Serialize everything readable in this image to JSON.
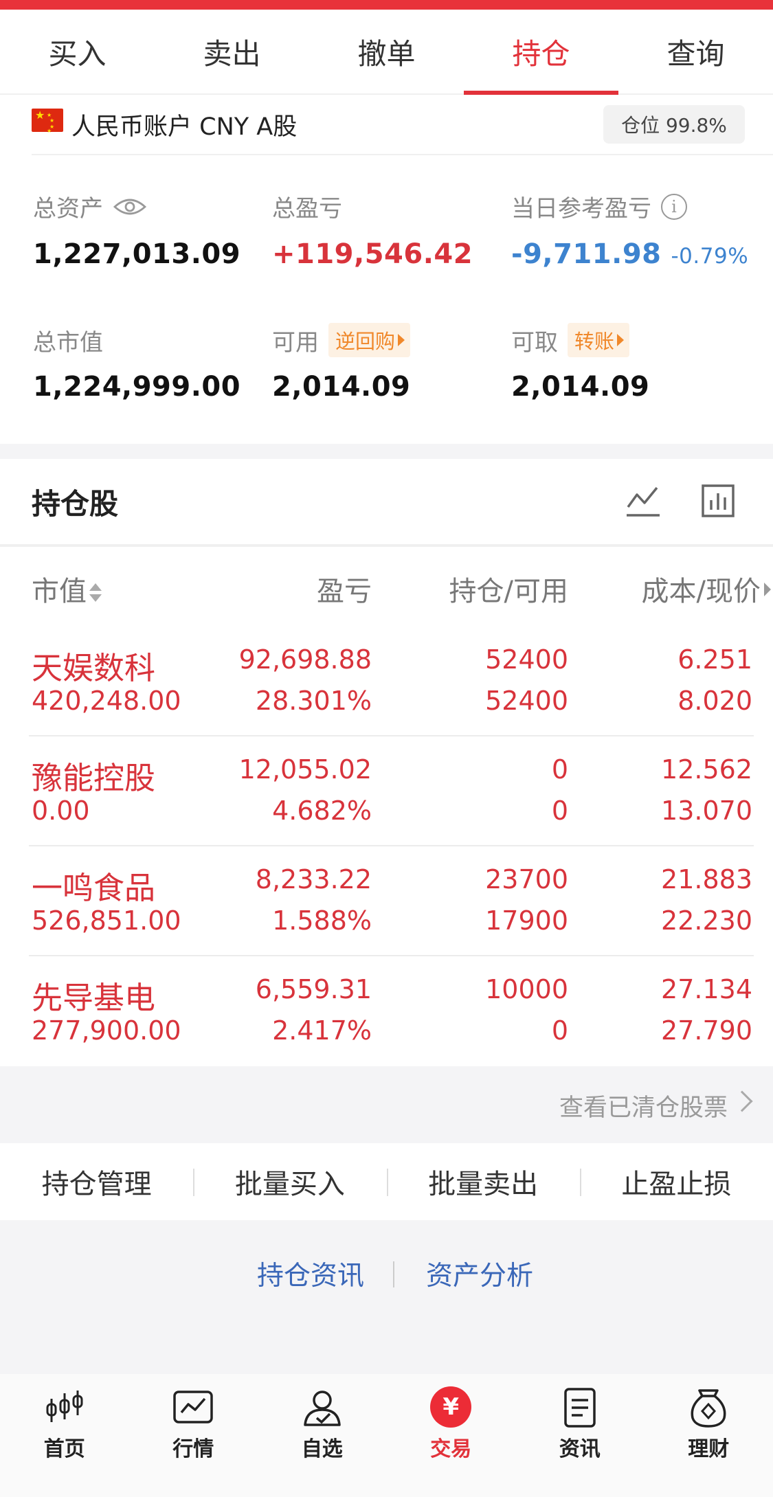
{
  "tabs": [
    {
      "label": "买入"
    },
    {
      "label": "卖出"
    },
    {
      "label": "撤单"
    },
    {
      "label": "持仓",
      "active": true
    },
    {
      "label": "查询"
    }
  ],
  "account": {
    "name": "人民币账户 CNY A股",
    "position": "仓位 99.8%"
  },
  "summary": {
    "total_assets_label": "总资产",
    "total_assets": "1,227,013.09",
    "total_pl_label": "总盈亏",
    "total_pl": "+119,546.42",
    "daily_pl_label": "当日参考盈亏",
    "daily_pl": "-9,711.98",
    "daily_pl_pct": "-0.79%",
    "market_value_label": "总市值",
    "market_value": "1,224,999.00",
    "available_label": "可用",
    "available_tag": "逆回购",
    "available": "2,014.09",
    "withdrawable_label": "可取",
    "withdrawable_tag": "转账",
    "withdrawable": "2,014.09"
  },
  "holdings": {
    "title": "持仓股",
    "columns": [
      "市值",
      "盈亏",
      "持仓/可用",
      "成本/现价"
    ],
    "rows": [
      {
        "name": "天娱数科",
        "market_value": "420,248.00",
        "pl": "92,698.88",
        "pl_pct": "28.301%",
        "held": "52400",
        "available": "52400",
        "cost": "6.251",
        "price": "8.020"
      },
      {
        "name": "豫能控股",
        "market_value": "0.00",
        "pl": "12,055.02",
        "pl_pct": "4.682%",
        "held": "0",
        "available": "0",
        "cost": "12.562",
        "price": "13.070"
      },
      {
        "name": "一鸣食品",
        "market_value": "526,851.00",
        "pl": "8,233.22",
        "pl_pct": "1.588%",
        "held": "23700",
        "available": "17900",
        "cost": "21.883",
        "price": "22.230"
      },
      {
        "name": "先导基电",
        "market_value": "277,900.00",
        "pl": "6,559.31",
        "pl_pct": "2.417%",
        "held": "10000",
        "available": "0",
        "cost": "27.134",
        "price": "27.790"
      }
    ]
  },
  "cleared_link": "查看已清仓股票",
  "actions": [
    "持仓管理",
    "批量买入",
    "批量卖出",
    "止盈止损"
  ],
  "info_links": [
    "持仓资讯",
    "资产分析"
  ],
  "bottom_nav": [
    {
      "label": "首页",
      "icon": "candlestick-icon"
    },
    {
      "label": "行情",
      "icon": "chart-icon"
    },
    {
      "label": "自选",
      "icon": "user-check-icon"
    },
    {
      "label": "交易",
      "icon": "yuan-icon",
      "symbol": "¥",
      "active": true
    },
    {
      "label": "资讯",
      "icon": "document-icon"
    },
    {
      "label": "理财",
      "icon": "money-bag-icon"
    }
  ],
  "colors": {
    "accent": "#e2323a",
    "gain": "#d8333b",
    "loss": "#3d83cf",
    "tag": "#f0882b",
    "link": "#3a67b8"
  }
}
